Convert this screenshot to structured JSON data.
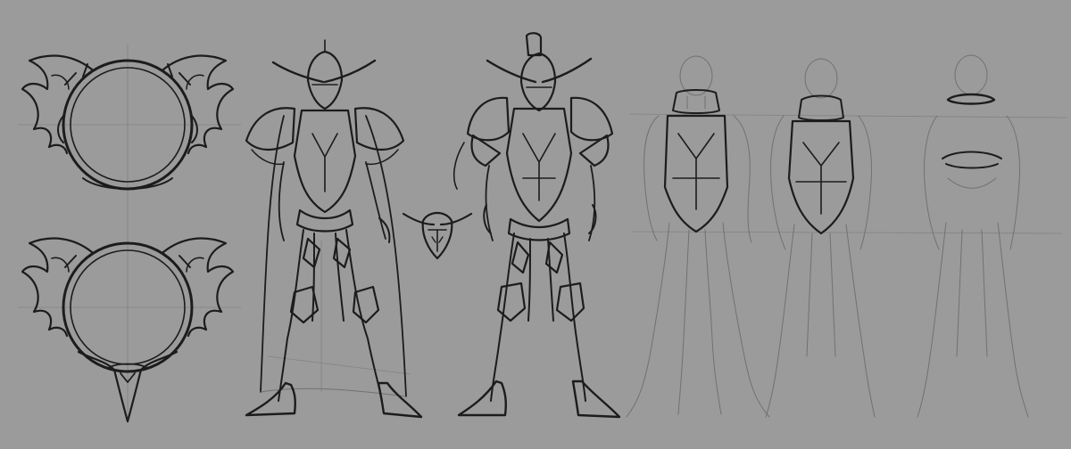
{
  "canvas": {
    "background": "#9b9b9b",
    "ink_color": "#1c1c1c",
    "sketch_color": "#6a6a6a"
  },
  "elements": {
    "frames": [
      "ornate-ring-frame-top",
      "ornate-ring-frame-bottom"
    ],
    "figures": [
      "armored-knight-caped",
      "armored-knight-plain",
      "body-base-front",
      "body-base-back",
      "body-base-front-2"
    ],
    "icons": [
      "helmet-emblem-icon"
    ]
  }
}
